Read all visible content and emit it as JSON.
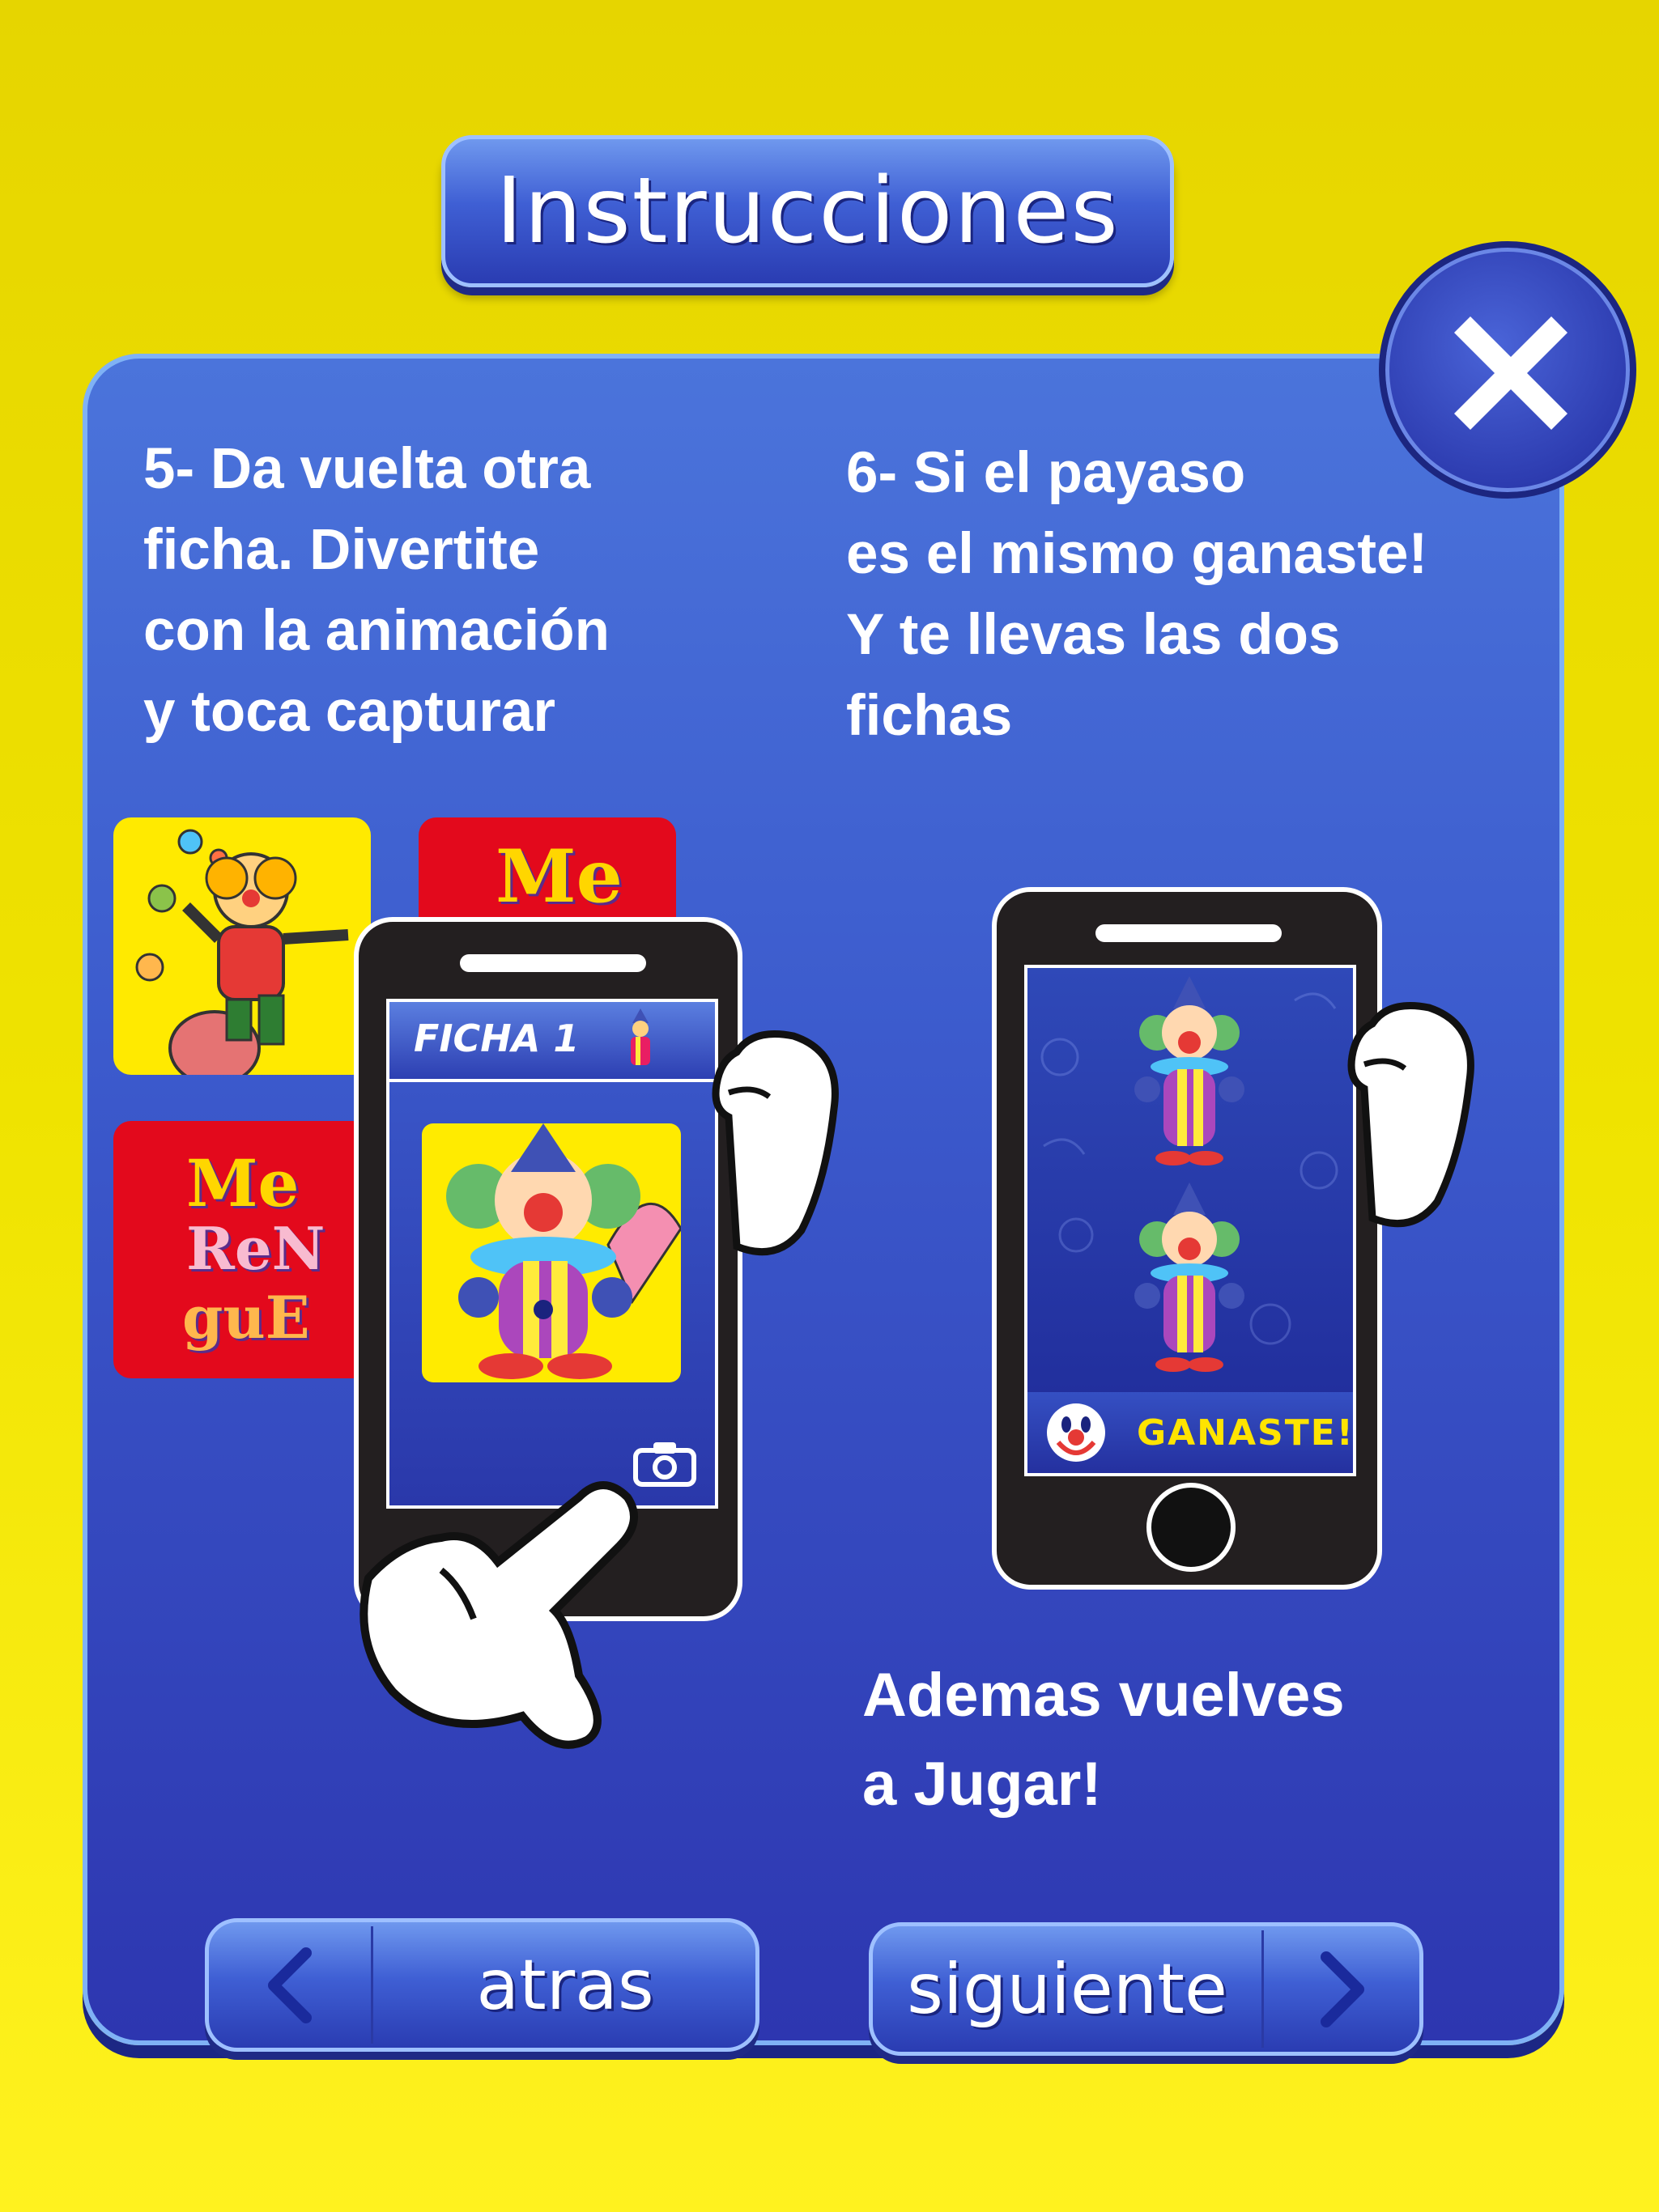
{
  "title": "Instrucciones",
  "steps": {
    "step5": "5- Da vuelta otra\nficha. Divertite\ncon la animación\ny toca capturar",
    "step6": "6- Si el payaso\nes el mismo ganaste!\nY te llevas las dos\nfichas",
    "extra": "Ademas vuelves\n a Jugar!"
  },
  "phone1": {
    "header": "FICHA 1"
  },
  "phone2": {
    "banner": "GANASTE!"
  },
  "logo_letters": [
    "Me",
    "ReN",
    "guE"
  ],
  "nav": {
    "back_label": "atras",
    "next_label": "siguiente"
  },
  "icons": [
    "close-icon",
    "camera-icon",
    "chevron-left-icon",
    "chevron-right-icon",
    "pointing-hand-icon"
  ],
  "colors": {
    "background": "#f0e400",
    "panel": "#3a55c8",
    "accent_border": "#7fb2f5",
    "banner_text": "#ffe400"
  }
}
